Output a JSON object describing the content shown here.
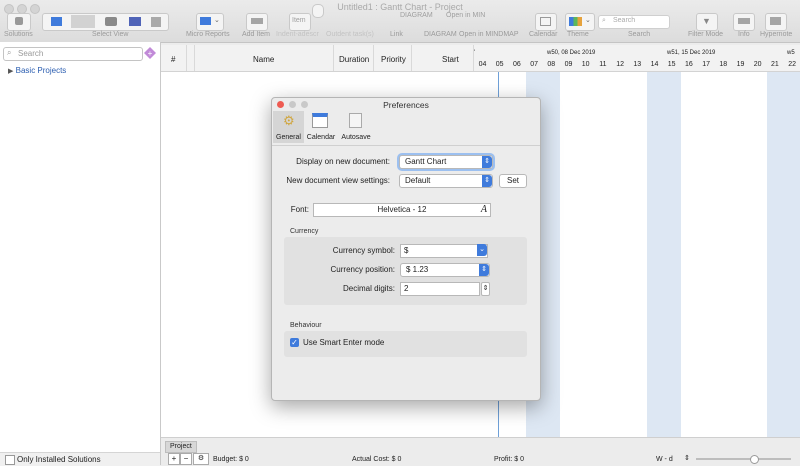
{
  "window": {
    "title": "Untitled1 : Gantt Chart - Project"
  },
  "toolbar": {
    "solutions": "Solutions",
    "select_view": "Select View",
    "micro_reports": "Micro Reports",
    "add_item": "Add Item",
    "indent": "Indent-adescr",
    "outdent": "Outdent task(s)",
    "link": "Link",
    "diagram": "DIAGRAM",
    "open_mindmap": "Open in MINDMAP",
    "calendar": "Calendar",
    "theme": "Theme",
    "search": "Search",
    "search_placeholder": "Search",
    "filter_mode": "Filter Mode",
    "info": "Info",
    "hypernote": "Hypernote",
    "ghost_diagram": "DIAGRAM",
    "ghost_open": "Open in MIN",
    "ghost_item": "Item"
  },
  "sidebar": {
    "search_placeholder": "Search",
    "items": [
      {
        "label": "Basic Projects"
      }
    ],
    "footer_label": "Only Installed Solutions"
  },
  "grid": {
    "columns": [
      "#",
      "Name",
      "Duration",
      "Priority",
      "Start"
    ]
  },
  "gantt": {
    "weeks": [
      "w50, 08 Dec 2019",
      "w51, 15 Dec 2019",
      "w5"
    ],
    "days": [
      "04",
      "05",
      "06",
      "07",
      "08",
      "09",
      "10",
      "11",
      "12",
      "13",
      "14",
      "15",
      "16",
      "17",
      "18",
      "19",
      "20",
      "21",
      "22"
    ]
  },
  "bottom": {
    "tab": "Project",
    "budget": "Budget: $ 0",
    "actual_cost": "Actual Cost: $ 0",
    "profit": "Profit: $ 0",
    "zoom": "W - d"
  },
  "preferences": {
    "title": "Preferences",
    "tabs": [
      {
        "label": "General"
      },
      {
        "label": "Calendar"
      },
      {
        "label": "Autosave"
      }
    ],
    "display_label": "Display on new document:",
    "display_value": "Gantt Chart",
    "view_settings_label": "New document view settings:",
    "view_settings_value": "Default",
    "set_button": "Set",
    "font_label": "Font:",
    "font_value": "Helvetica - 12",
    "font_icon": "A",
    "currency_section": "Currency",
    "currency_symbol_label": "Currency symbol:",
    "currency_symbol_value": "$",
    "currency_position_label": "Currency position:",
    "currency_position_value": "$ 1.23",
    "decimal_label": "Decimal digits:",
    "decimal_value": "2",
    "behaviour_section": "Behaviour",
    "smart_enter_label": "Use Smart Enter mode"
  },
  "colors": {
    "accent": "#3f7bdc",
    "week_shade": "#dde7f3",
    "close": "#ee5b52",
    "today_line": "#6fa0d8"
  }
}
